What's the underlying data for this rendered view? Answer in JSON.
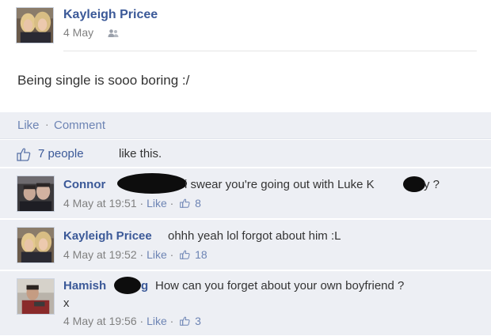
{
  "post": {
    "author": "Kayleigh Pricee",
    "date": "4 May",
    "status": "Being single is sooo boring :/",
    "actions": {
      "like": "Like",
      "separator": "·",
      "comment": "Comment"
    },
    "likes": {
      "count_text": "7 people",
      "suffix": "like this."
    }
  },
  "comments": [
    {
      "author": "Connor",
      "text": "i swear you're going out with Luke K",
      "text_tail": "y ?",
      "timestamp": "4 May at 19:51",
      "like_label": "Like",
      "separator": "·",
      "likes": "8"
    },
    {
      "author": "Kayleigh Pricee",
      "text": "ohhh yeah lol forgot about him :L",
      "timestamp": "4 May at 19:52",
      "like_label": "Like",
      "separator": "·",
      "likes": "18"
    },
    {
      "author": "Hamish",
      "author_tail": "g",
      "text": "How can you forget about your own boyfriend ?",
      "text_line2": "x",
      "timestamp": "4 May at 19:56",
      "like_label": "Like",
      "separator": "·",
      "likes": "3"
    }
  ],
  "colors": {
    "link": "#3b5998",
    "action_link": "#6d84b4",
    "comment_bg": "#edeff4",
    "meta_text": "#808080"
  },
  "icons": [
    "audience-friends-icon",
    "like-thumb-icon",
    "comment-like-thumb-icon"
  ]
}
